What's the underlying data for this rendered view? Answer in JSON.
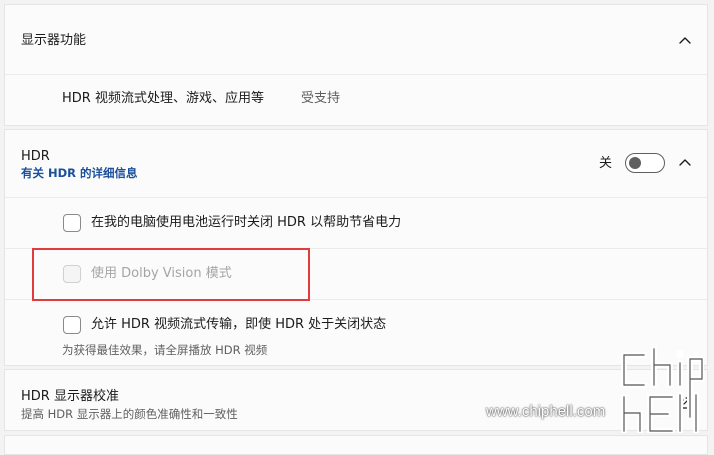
{
  "display_features": {
    "title": "显示器功能",
    "item_label": "HDR 视频流式处理、游戏、应用等",
    "item_status": "受支持"
  },
  "hdr": {
    "title": "HDR",
    "link": "有关 HDR 的详细信息",
    "toggle_label": "关",
    "toggle_on": false,
    "options": [
      {
        "label": "在我的电脑使用电池运行时关闭 HDR 以帮助节省电力",
        "enabled": true,
        "checked": false
      },
      {
        "label": "使用 Dolby Vision 模式",
        "enabled": false,
        "checked": false
      },
      {
        "label": "允许 HDR 视频流式传输，即使 HDR 处于关闭状态",
        "enabled": true,
        "checked": false
      }
    ],
    "option_hint": "为获得最佳效果，请全屏播放 HDR 视频"
  },
  "calibration": {
    "title": "HDR 显示器校准",
    "subtitle": "提高 HDR 显示器上的颜色准确性和一致性"
  },
  "watermark": {
    "text": "www.chiphell.com"
  }
}
